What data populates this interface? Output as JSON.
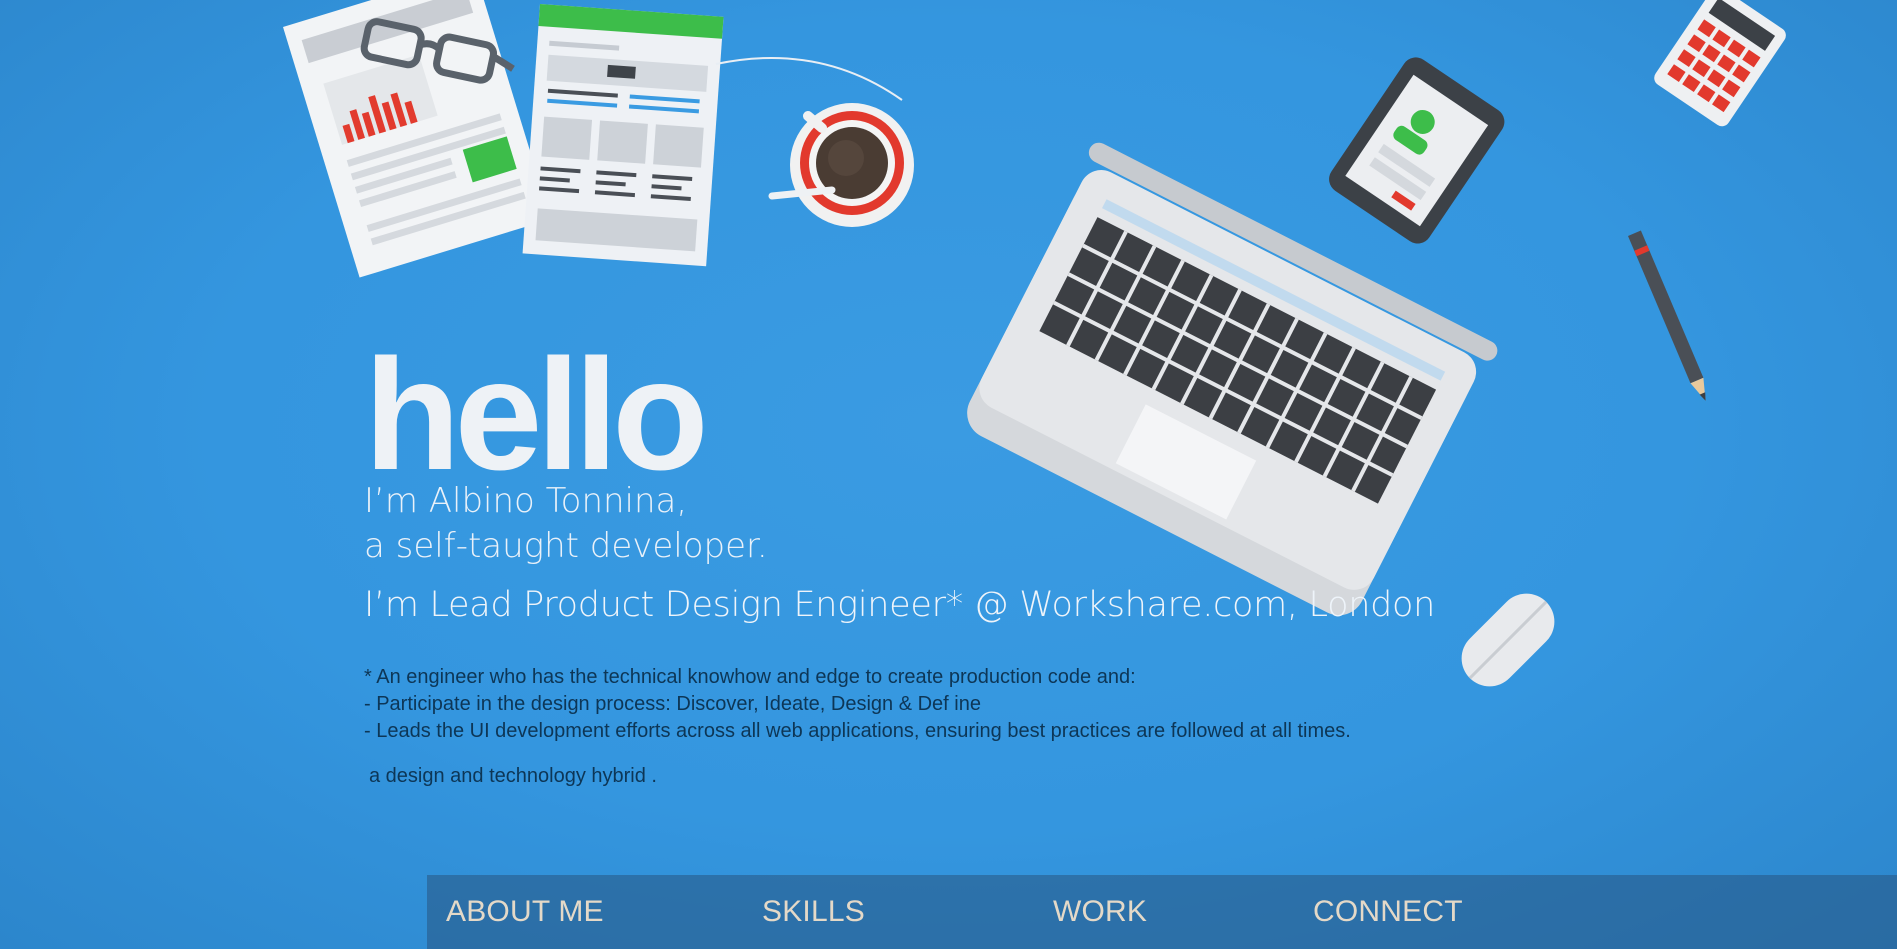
{
  "hero": {
    "title": "hello",
    "intro_line1": "I’m Albino Tonnina,",
    "intro_line2": "a self-taught developer.",
    "role": "I’m Lead Product Design Engineer* @ Workshare.com, London",
    "footnotes": [
      "* An engineer who has the technical knowhow and edge to create production code and:",
      "- Participate in the design process: Discover, Ideate, Design & Def ine",
      "- Leads the UI development efforts across all web applications, ensuring best practices are followed at all times."
    ],
    "tagline": "a design and technology hybrid ."
  },
  "nav": {
    "items": [
      "ABOUT ME",
      "SKILLS",
      "WORK",
      "CONNECT"
    ]
  },
  "colors": {
    "background": "#3496df",
    "nav_bar": "#2f6ea6",
    "nav_text": "#e4d9c8",
    "footnote_text": "#0d3656"
  },
  "icons": [
    "report-sheet-icon",
    "glasses-icon",
    "wireframe-sheet-icon",
    "coffee-cup-icon",
    "laptop-icon",
    "phone-icon",
    "calculator-icon",
    "pencil-icon",
    "mouse-icon"
  ]
}
